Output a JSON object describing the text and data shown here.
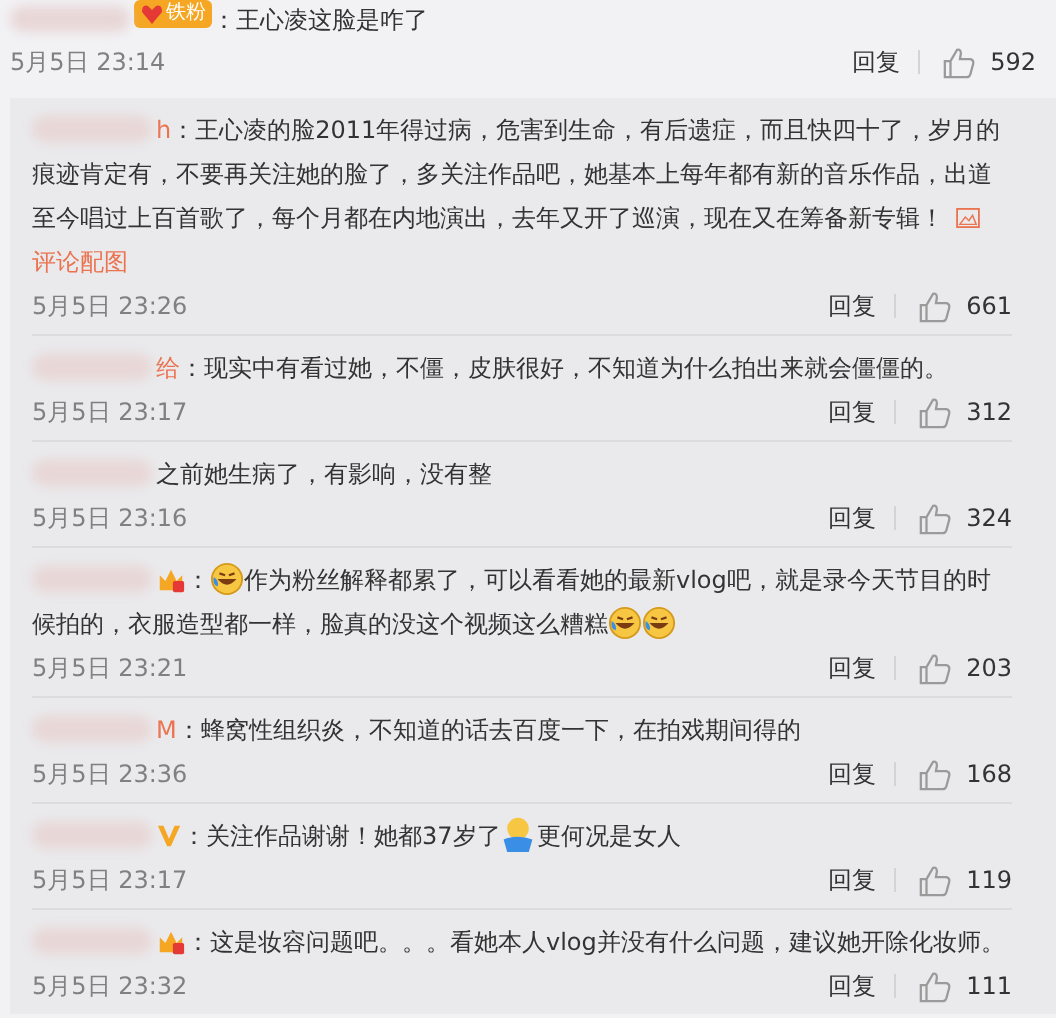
{
  "comment": {
    "badge": {
      "kind": "fan",
      "label": "铁粉"
    },
    "parts": [
      {
        "kind": "text",
        "text": "：王心凌这脸是咋了"
      }
    ],
    "time": "5月5日 23:14",
    "reply_label": "回复",
    "likes": "592"
  },
  "replies": [
    {
      "name_tail": "h",
      "parts": [
        {
          "kind": "text",
          "text": "：王心凌的脸2011年得过病，危害到生命，有后遗症，而且快四十了，岁月的痕迹肯定有，不要再关注她的脸了，多关注作品吧，她基本上每年都有新的音乐作品，出道至今唱过上百首歌了，每个月都在内地演出，去年又开了巡演，现在又在筹备新专辑！"
        }
      ],
      "image_link": "评论配图",
      "time": "5月5日 23:26",
      "reply_label": "回复",
      "likes": "661"
    },
    {
      "name_tail": "给",
      "parts": [
        {
          "kind": "text",
          "text": "：现实中有看过她，不僵，皮肤很好，不知道为什么拍出来就会僵僵的。"
        }
      ],
      "time": "5月5日 23:17",
      "reply_label": "回复",
      "likes": "312"
    },
    {
      "parts": [
        {
          "kind": "text",
          "text": "之前她生病了，有影响，没有整"
        }
      ],
      "time": "5月5日 23:16",
      "reply_label": "回复",
      "likes": "324"
    },
    {
      "badge": {
        "kind": "level"
      },
      "parts": [
        {
          "kind": "text",
          "text": "："
        },
        {
          "kind": "laugh"
        },
        {
          "kind": "text",
          "text": "作为粉丝解释都累了，可以看看她的最新vlog吧，就是录今天节目的时候拍的，衣服造型都一样，脸真的没这个视频这么糟糕"
        },
        {
          "kind": "laugh"
        },
        {
          "kind": "laugh"
        }
      ],
      "time": "5月5日 23:21",
      "reply_label": "回复",
      "likes": "203"
    },
    {
      "name_tail": "M",
      "parts": [
        {
          "kind": "text",
          "text": "：蜂窝性组织炎，不知道的话去百度一下，在拍戏期间得的"
        }
      ],
      "time": "5月5日 23:36",
      "reply_label": "回复",
      "likes": "168"
    },
    {
      "badge": {
        "kind": "verified"
      },
      "parts": [
        {
          "kind": "text",
          "text": "：关注作品谢谢！她都37岁了"
        },
        {
          "kind": "shrug"
        },
        {
          "kind": "text",
          "text": "更何况是女人"
        }
      ],
      "time": "5月5日 23:17",
      "reply_label": "回复",
      "likes": "119"
    },
    {
      "badge": {
        "kind": "level"
      },
      "parts": [
        {
          "kind": "text",
          "text": "：这是妆容问题吧。。。看她本人vlog并没有什么问题，建议她开除化妆师。"
        }
      ],
      "time": "5月5日 23:32",
      "reply_label": "回复",
      "likes": "111"
    }
  ]
}
